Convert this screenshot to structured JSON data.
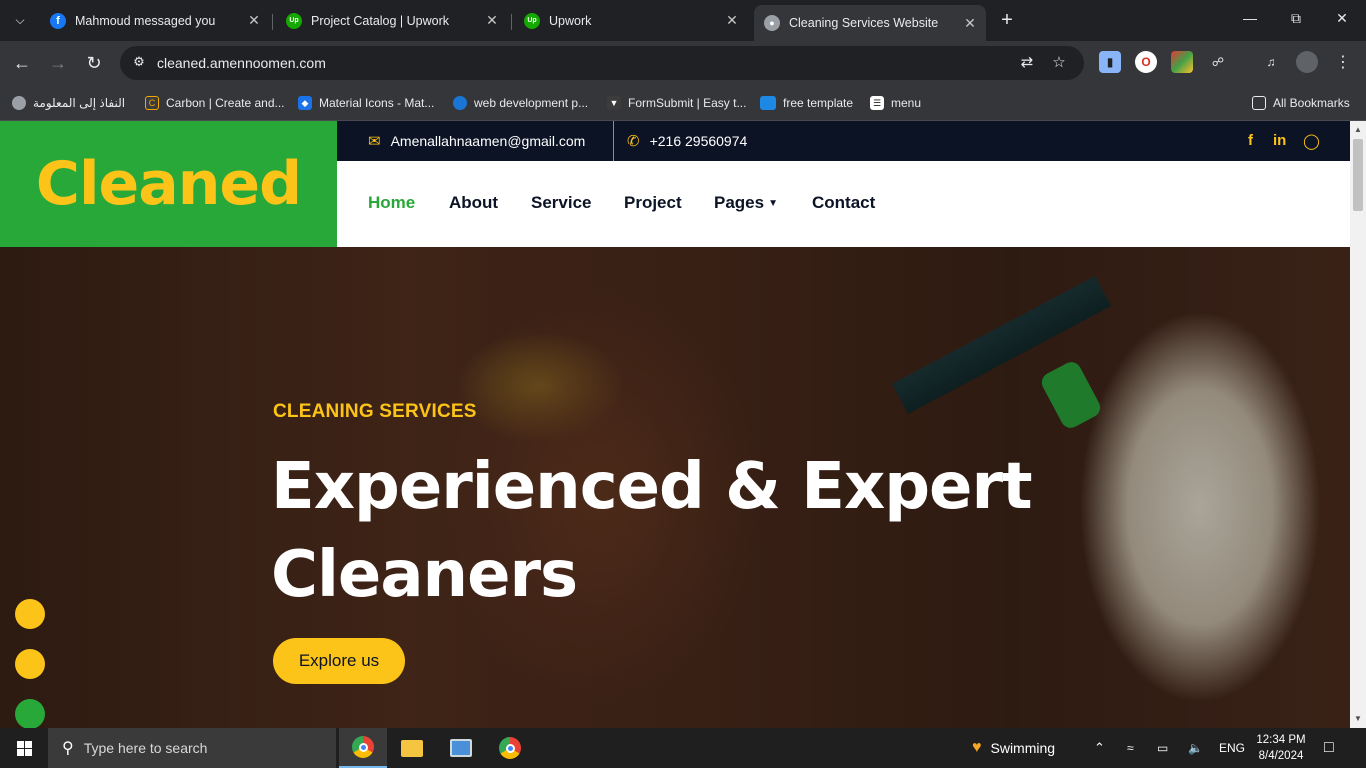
{
  "browser": {
    "tabs": [
      {
        "title": "Mahmoud messaged you",
        "favicon": "facebook-icon",
        "active": false
      },
      {
        "title": "Project Catalog | Upwork",
        "favicon": "upwork-icon",
        "active": false
      },
      {
        "title": "Upwork",
        "favicon": "upwork-icon",
        "active": false
      },
      {
        "title": "Cleaning Services Website",
        "favicon": "globe-icon",
        "active": true
      }
    ],
    "url": "cleaned.amennoomen.com",
    "bookmarks": [
      {
        "label": "النفاذ إلى المعلومة",
        "icon": "globe-icon"
      },
      {
        "label": "Carbon | Create and...",
        "icon": "carbon-icon"
      },
      {
        "label": "Material Icons - Mat...",
        "icon": "material-icons-icon"
      },
      {
        "label": "web development p...",
        "icon": "bookmark-icon"
      },
      {
        "label": "FormSubmit | Easy t...",
        "icon": "formsubmit-icon"
      },
      {
        "label": "free template",
        "icon": "template-icon"
      },
      {
        "label": "menu",
        "icon": "menu-icon"
      }
    ],
    "all_bookmarks": "All Bookmarks"
  },
  "site": {
    "logo": "Cleaned",
    "email": "Amenallahnaamen@gmail.com",
    "phone": "+216 29560974",
    "social": [
      "facebook-icon",
      "linkedin-icon",
      "instagram-icon"
    ],
    "nav": [
      {
        "label": "Home",
        "active": true
      },
      {
        "label": "About",
        "active": false
      },
      {
        "label": "Service",
        "active": false
      },
      {
        "label": "Project",
        "active": false
      },
      {
        "label": "Pages",
        "active": false,
        "dropdown": true
      },
      {
        "label": "Contact",
        "active": false
      }
    ],
    "hero": {
      "subtitle": "CLEANING SERVICES",
      "headline_line1": "Experienced & Expert",
      "headline_line2": "Cleaners",
      "cta": "Explore us"
    },
    "colors": {
      "brand_green": "#28a838",
      "accent_yellow": "#fcc419",
      "dark_navy": "#0b1325"
    }
  },
  "taskbar": {
    "search_placeholder": "Type here to search",
    "weather": "Swimming",
    "language": "ENG",
    "time": "12:34 PM",
    "date": "8/4/2024"
  }
}
